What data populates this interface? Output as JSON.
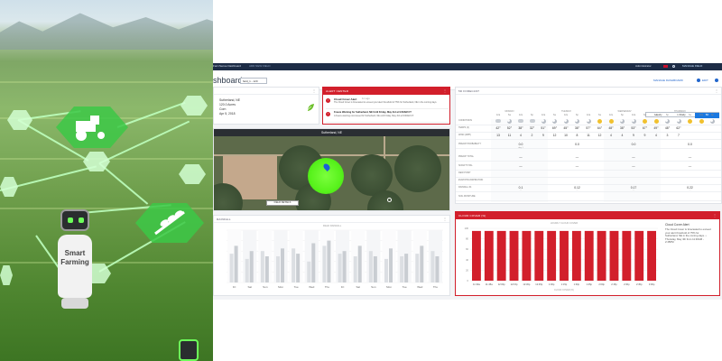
{
  "photo": {
    "robot_text": "Smart\nFarming"
  },
  "topbar": {
    "logo": "FarmSense Dashboard",
    "subtitle": "ADD NEW FIELD",
    "user": "Administrator",
    "field_menu": "MANAGE FIELD"
  },
  "page": {
    "title": "shboards",
    "field_select": "field_1 - 120",
    "add_widget": "MANAGE DASHBOARD",
    "edit": "EDIT"
  },
  "field_info": {
    "header": "",
    "name": "Sutherland, NE",
    "acres": "120.0 Acres",
    "crop": "Corn",
    "date": "Apr 5, 2018"
  },
  "alerts": {
    "header": "ALERT CENTER",
    "items": [
      {
        "title": "Cloud Cover Alert",
        "time": "1m ago",
        "desc": "The Cloud Cover is forecasted to exceed your alert threshold of 75% for Sutherland, NE in the coming days."
      },
      {
        "title": "Freeze Warning for Sutherland, NE Until Friday, May 3rd at 9:00AM CT",
        "time": "",
        "desc": "A freeze warning now issued for Sutherland, NE until Friday, May 3rd at 9:00AM CT."
      }
    ]
  },
  "map": {
    "label": "Sutherland, NE",
    "button": "FIELD DETAILS"
  },
  "forecast": {
    "header": "5D FORECAST",
    "toggles": [
      "Hourly",
      "Daily",
      "5D"
    ],
    "active_toggle": "5D",
    "row_labels": [
      "CONDITIONS",
      "TEMPS (F)",
      "WIND (MPH)",
      "PRECIP PROBABILITY",
      "PRECIP TOTAL",
      "SNOW TOTAL",
      "DEW POINT",
      "EVAPOTRANSPIRATION",
      "RAINFALL IN.",
      "SOIL MOISTURE"
    ],
    "days": [
      "MONDAY",
      "TUESDAY",
      "WEDNESDAY",
      "THURSDAY"
    ],
    "times": [
      "12a",
      "6a",
      "12p",
      "6p",
      "12a",
      "6a",
      "12p",
      "6p",
      "12a",
      "6a",
      "12p",
      "6p",
      "12a",
      "6a",
      "12p",
      "6p",
      "12a",
      "6a",
      "12p",
      "6p"
    ],
    "conditions": [
      "cloud",
      "moon",
      "cloud",
      "cloud",
      "moon",
      "moon",
      "moon",
      "moon",
      "moon",
      "sun",
      "sun",
      "moon",
      "moon",
      "sun",
      "sun",
      "moon",
      "moon",
      "sun",
      "sun",
      "moon"
    ],
    "temps": [
      "42°",
      "52°",
      "38°",
      "32°",
      "51°",
      "69°",
      "45°",
      "38°",
      "57°",
      "64°",
      "48°",
      "38°",
      "53°",
      "67°",
      "49°",
      "48°",
      "62°"
    ],
    "wind": [
      "13",
      "11",
      "4",
      "2",
      "9",
      "12",
      "10",
      "8",
      "11",
      "12",
      "4",
      "4",
      "9",
      "9",
      "4",
      "3",
      "7"
    ],
    "precip_prob": [
      "0.0",
      "0.0",
      "0.0",
      "0.0"
    ],
    "precip_note": "day 1",
    "rain": [
      "0.1",
      "0.12",
      "0.17",
      "0.22"
    ],
    "dash": "—"
  },
  "rain_chart": {
    "header": "RAINFALL",
    "subtitle": "FIELD RAINFALL"
  },
  "cloud_chart": {
    "header": "CLOUD COVER (%)",
    "subtitle": "HOURLY CLOUD COVER",
    "x_label": "CLOUD COVER (%)",
    "alert_title": "Cloud Cover Alert",
    "alert_body": "The Cloud Cover is forecasted to exceed your alert threshold of 75% for Sutherland, NE in the coming days. • Thursday, May 4th from 11:30AM - 2:45PM"
  },
  "chart_data": [
    {
      "type": "bar",
      "title": "",
      "categories": [
        "Fri",
        "Sat",
        "Sun",
        "Mon",
        "Tue",
        "Wed",
        "Thu",
        "Fri",
        "Sat",
        "Sun",
        "Mon",
        "Tue",
        "Wed",
        "Thu"
      ],
      "series": [
        {
          "values": [
            0.55,
            0.45,
            0.6,
            0.5,
            0.65,
            0.4,
            0.7,
            0.55,
            0.5,
            0.6,
            0.45,
            0.5,
            0.55,
            0.6
          ]
        },
        {
          "values": [
            0.7,
            0.6,
            0.5,
            0.65,
            0.55,
            0.75,
            0.8,
            0.6,
            0.7,
            0.5,
            0.65,
            0.55,
            0.7,
            0.5
          ]
        }
      ],
      "ylim": [
        0,
        1
      ],
      "grid": true
    },
    {
      "type": "bar",
      "title": "",
      "categories": [
        "11:30a",
        "11:45a",
        "12:00p",
        "12:15p",
        "12:30p",
        "12:45p",
        "1:00p",
        "1:15p",
        "1:30p",
        "1:45p",
        "2:00p",
        "2:15p",
        "2:30p",
        "2:45p",
        "3:00p"
      ],
      "values": [
        95,
        95,
        95,
        95,
        95,
        95,
        95,
        95,
        95,
        95,
        95,
        95,
        95,
        95,
        95
      ],
      "ylim": [
        0,
        100
      ],
      "xlabel": "CLOUD COVER (%)",
      "ylabel": ""
    }
  ]
}
